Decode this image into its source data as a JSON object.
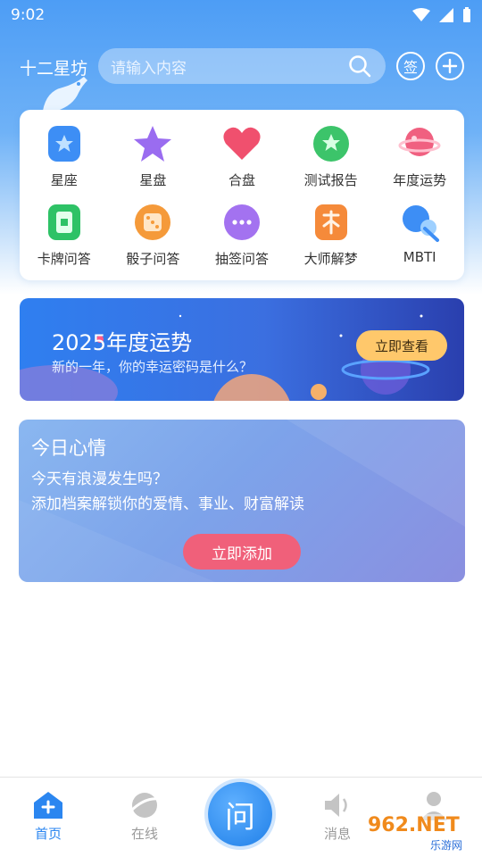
{
  "status_bar": {
    "time": "9:02"
  },
  "header": {
    "app_title": "十二星坊",
    "search_placeholder": "请输入内容",
    "sign_label": "签"
  },
  "grid": {
    "items": [
      {
        "label": "星座",
        "icon": "constellation-icon",
        "color": "#3d8ef5"
      },
      {
        "label": "星盘",
        "icon": "star-icon",
        "color": "#9a6cf0"
      },
      {
        "label": "合盘",
        "icon": "heart-icon",
        "color": "#f0506e"
      },
      {
        "label": "测试报告",
        "icon": "test-report-icon",
        "color": "#3cc46a"
      },
      {
        "label": "年度运势",
        "icon": "planet-icon",
        "color": "#f06080"
      },
      {
        "label": "卡牌问答",
        "icon": "card-icon",
        "color": "#2ec266"
      },
      {
        "label": "骰子问答",
        "icon": "dice-icon",
        "color": "#f59a3a"
      },
      {
        "label": "抽签问答",
        "icon": "chat-bubble-icon",
        "color": "#a372f0"
      },
      {
        "label": "大师解梦",
        "icon": "dream-icon",
        "color": "#f58a3a"
      },
      {
        "label": "MBTI",
        "icon": "mbti-icon",
        "color": "#3d8ef5"
      }
    ]
  },
  "banner": {
    "title": "2025年度运势",
    "subtitle": "新的一年，你的幸运密码是什么？",
    "button": "立即查看"
  },
  "mood": {
    "title": "今日心情",
    "line1": "今天有浪漫发生吗？",
    "line2": "添加档案解锁你的爱情、事业、财富解读",
    "button": "立即添加"
  },
  "tabbar": {
    "tabs": [
      {
        "label": "首页",
        "icon": "home-icon",
        "active": true
      },
      {
        "label": "在线",
        "icon": "planet-icon",
        "active": false
      },
      {
        "label": "问",
        "icon": "ask-icon",
        "active": false
      },
      {
        "label": "消息",
        "icon": "speaker-icon",
        "active": false
      }
    ]
  },
  "watermark": {
    "text": "962.NET",
    "sub": "乐游网"
  },
  "colors": {
    "accent": "#2b86f0",
    "banner_button": "#ffc86b",
    "mood_button": "#f0607a"
  }
}
